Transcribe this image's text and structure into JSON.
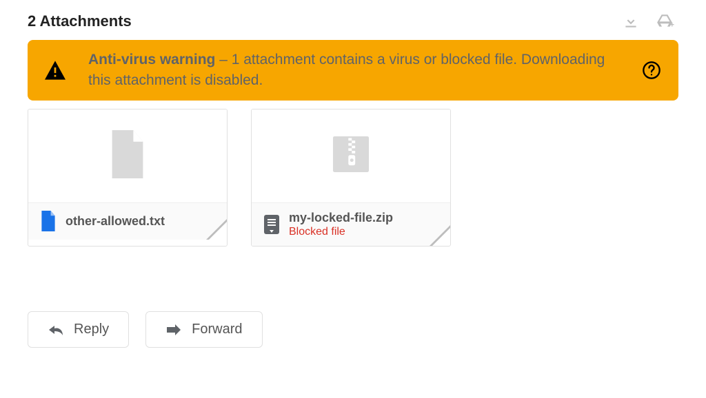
{
  "header": {
    "title": "2 Attachments"
  },
  "warning": {
    "title": "Anti-virus warning",
    "separator": " – ",
    "message": "1 attachment contains a virus or blocked file. Downloading this attachment is disabled."
  },
  "attachments": [
    {
      "filename": "other-allowed.txt",
      "status": "",
      "type": "txt",
      "blocked": false
    },
    {
      "filename": "my-locked-file.zip",
      "status": "Blocked file",
      "type": "zip",
      "blocked": true
    }
  ],
  "actions": {
    "reply": "Reply",
    "forward": "Forward"
  }
}
